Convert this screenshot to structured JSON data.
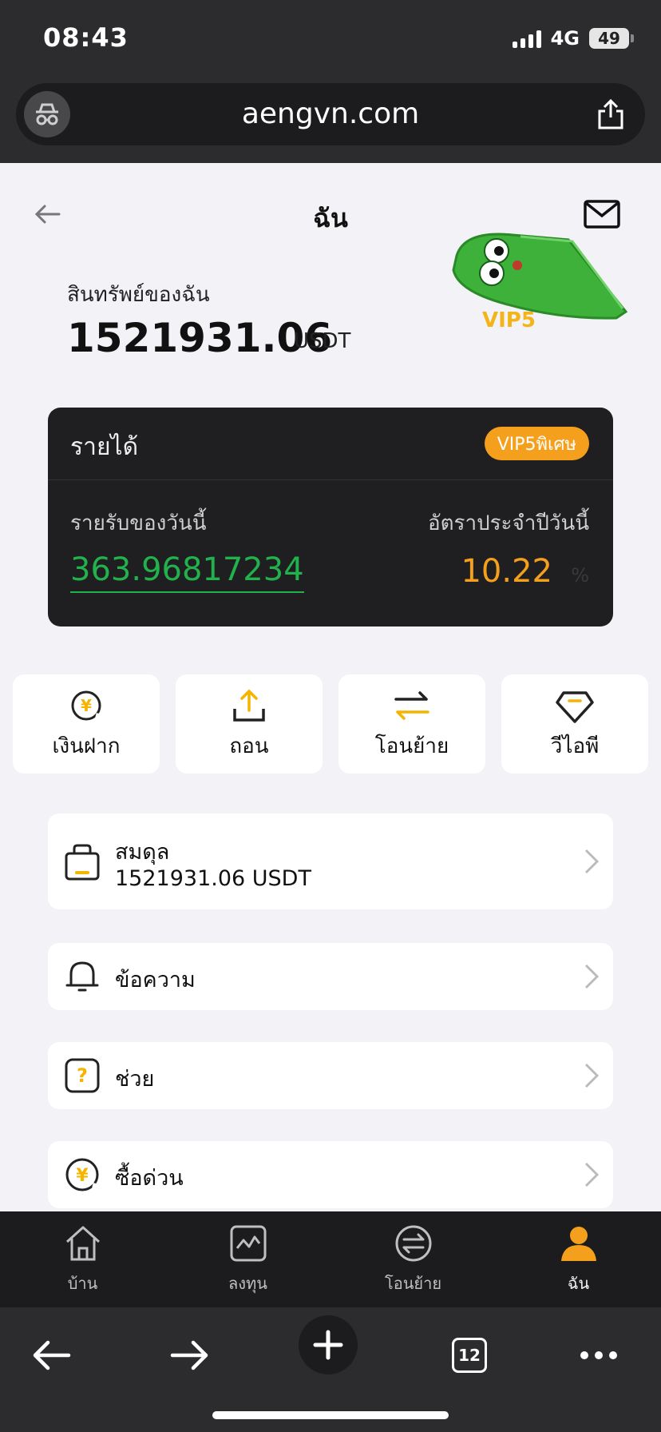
{
  "status": {
    "time": "08:43",
    "network": "4G",
    "battery": "49"
  },
  "browser": {
    "url": "aengvn.com",
    "tabs_count": "12"
  },
  "header": {
    "title": "ฉัน"
  },
  "assets": {
    "label": "สินทรัพย์ของฉัน",
    "value": "1521931.06",
    "unit": "USDT",
    "vip_level": "VIP5"
  },
  "income": {
    "title": "รายได้",
    "badge": "VIP5พิเศษ",
    "today_label": "รายรับของวันนี้",
    "today_value": "363.96817234",
    "rate_label": "อัตราประจำปีวันนี้",
    "rate_value": "10.22",
    "rate_unit": "%"
  },
  "actions": [
    {
      "label": "เงินฝาก",
      "icon": "deposit-icon"
    },
    {
      "label": "ถอน",
      "icon": "withdraw-icon"
    },
    {
      "label": "โอนย้าย",
      "icon": "transfer-icon"
    },
    {
      "label": "วีไอพี",
      "icon": "diamond-icon"
    }
  ],
  "menu": [
    {
      "label": "สมดุล",
      "sub": "1521931.06 USDT",
      "icon": "wallet-icon"
    },
    {
      "label": "ข้อความ",
      "icon": "bell-icon"
    },
    {
      "label": "ช่วย",
      "icon": "help-icon"
    },
    {
      "label": "ซื้อด่วน",
      "icon": "quick-buy-icon"
    }
  ],
  "tabbar": [
    {
      "label": "บ้าน",
      "icon": "home-icon"
    },
    {
      "label": "ลงทุน",
      "icon": "chart-icon"
    },
    {
      "label": "โอนย้าย",
      "icon": "exchange-icon"
    },
    {
      "label": "ฉัน",
      "icon": "user-icon",
      "active": true
    }
  ],
  "colors": {
    "accent": "#f4a01d",
    "green": "#22b14c",
    "card_dark": "#1f1f21"
  }
}
